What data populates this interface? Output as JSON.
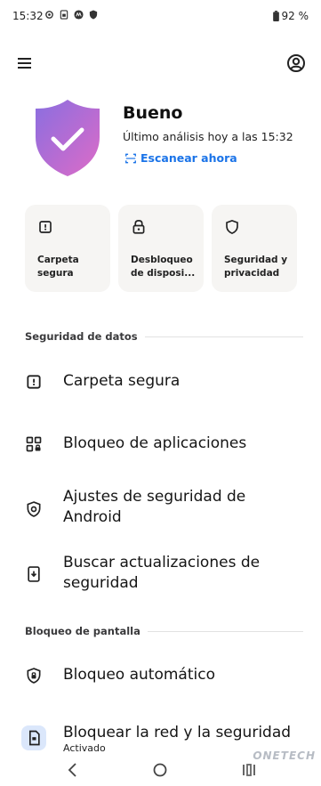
{
  "status_bar": {
    "time": "15:32",
    "battery": "92 %",
    "icons": [
      "settings-gear-icon",
      "sim-icon",
      "motorola-icon",
      "shield-icon"
    ]
  },
  "header": {
    "menu_icon": "hamburger-menu-icon",
    "account_icon": "account-circle-icon"
  },
  "summary": {
    "status": "Bueno",
    "last_scan": "Último análisis hoy a las 15:32",
    "scan_action": "Escanear ahora",
    "shield_gradient": [
      "#8a6ee0",
      "#dd6bc7"
    ]
  },
  "cards": [
    {
      "label": "Carpeta segura",
      "icon": "secure-folder-icon"
    },
    {
      "label": "Desbloqueo de disposi...",
      "icon": "lock-icon"
    },
    {
      "label": "Seguridad y privacidad",
      "icon": "shield-outline-icon"
    }
  ],
  "sections": [
    {
      "title": "Seguridad de datos",
      "items": [
        {
          "label": "Carpeta segura",
          "icon": "secure-folder-icon"
        },
        {
          "label": "Bloqueo de aplicaciones",
          "icon": "app-grid-lock-icon"
        },
        {
          "label": "Ajustes de seguridad de Android",
          "icon": "shield-gear-icon"
        },
        {
          "label": "Buscar actualizaciones de seguridad",
          "icon": "system-update-icon"
        }
      ]
    },
    {
      "title": "Bloqueo de pantalla",
      "items": [
        {
          "label": "Bloqueo automático",
          "icon": "shield-lock-icon"
        },
        {
          "label": "Bloquear la red y la seguridad",
          "sublabel": "Activado",
          "icon": "lock-network-icon"
        }
      ]
    }
  ],
  "colors": {
    "accent": "#1a73e8",
    "card_bg": "#f6f5f3",
    "text": "#151515",
    "active_icon_bg": "#dbe7fb"
  },
  "watermark": "ONETECH"
}
